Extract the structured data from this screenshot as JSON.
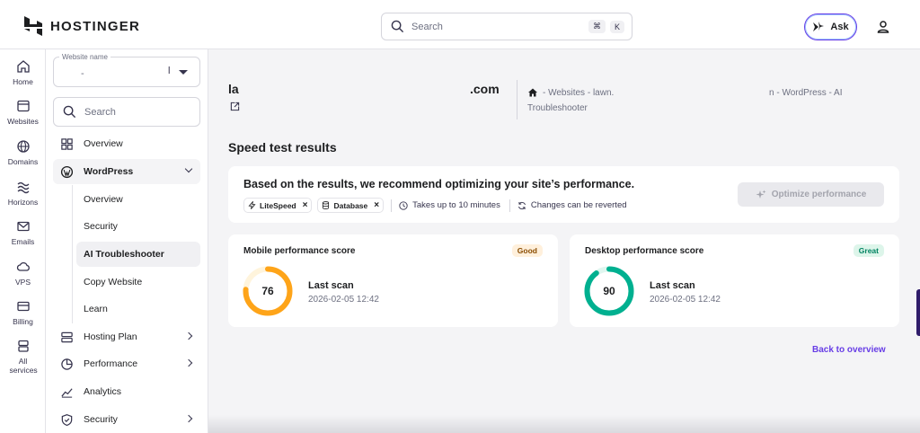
{
  "brand": {
    "name": "HOSTINGER",
    "accent": "#673de6"
  },
  "top_search": {
    "placeholder": "Search",
    "shortcut_mod": "⌘",
    "shortcut_key": "K"
  },
  "ask_button": {
    "label": "Ask"
  },
  "rail": [
    {
      "label": "Home",
      "icon": "home-icon"
    },
    {
      "label": "Websites",
      "icon": "browser-icon"
    },
    {
      "label": "Domains",
      "icon": "globe-icon"
    },
    {
      "label": "Horizons",
      "icon": "waves-icon"
    },
    {
      "label": "Emails",
      "icon": "mail-icon"
    },
    {
      "label": "VPS",
      "icon": "cloud-icon"
    },
    {
      "label": "Billing",
      "icon": "card-icon"
    },
    {
      "label": "All services",
      "icon": "stack-icon"
    }
  ],
  "sidebar": {
    "website_select": {
      "legend": "Website name",
      "value": "-",
      "value_tail": "l"
    },
    "search_placeholder": "Search",
    "items": {
      "overview": "Overview",
      "wordpress": "WordPress",
      "hosting_plan": "Hosting Plan",
      "performance": "Performance",
      "analytics": "Analytics",
      "security": "Security"
    },
    "wordpress_sub": {
      "overview": "Overview",
      "security": "Security",
      "ai_troubleshooter": "AI Troubleshooter",
      "copy_website": "Copy Website",
      "learn": "Learn"
    }
  },
  "header": {
    "site_title_start": "la",
    "site_title_end": ".com",
    "breadcrumb_part1": "- Websites - lawn.",
    "breadcrumb_part2": "n - WordPress - AI",
    "breadcrumb_part3": "Troubleshooter"
  },
  "section_title": "Speed test results",
  "recommendation": {
    "title": "Based on the results, we recommend optimizing your site’s performance.",
    "chips": [
      "LiteSpeed",
      "Database"
    ],
    "info_time": "Takes up to 10 minutes",
    "info_revert": "Changes can be reverted",
    "button": "Optimize performance"
  },
  "scores": {
    "mobile": {
      "title": "Mobile performance score",
      "badge": "Good",
      "score": "76",
      "score_value": 76,
      "color": "#fea419",
      "last_scan_label": "Last scan",
      "last_scan": "2026-02-05 12:42"
    },
    "desktop": {
      "title": "Desktop performance score",
      "badge": "Great",
      "score": "90",
      "score_value": 90,
      "color": "#00b090",
      "last_scan_label": "Last scan",
      "last_scan": "2026-02-05 12:42"
    }
  },
  "back_link": "Back to overview"
}
